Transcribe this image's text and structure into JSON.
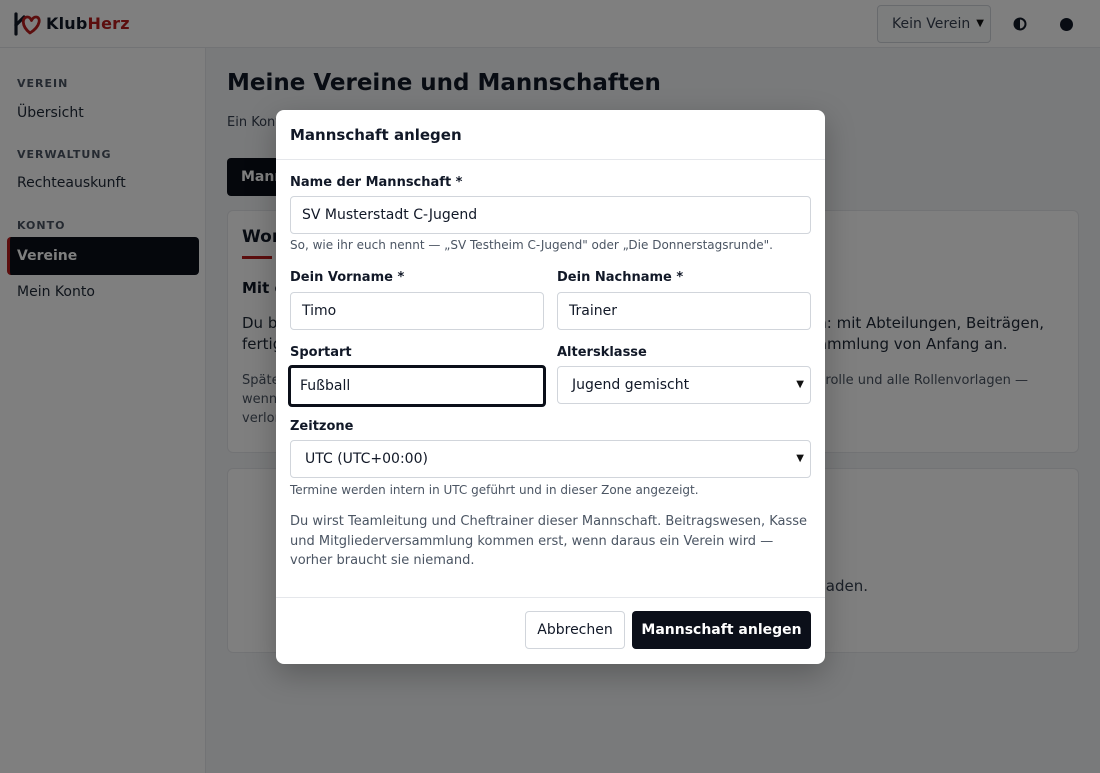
{
  "brand": {
    "name_part1": "Klub",
    "name_part2": "Herz",
    "accent": "#b91c1c"
  },
  "header": {
    "club_select": "Kein Verein",
    "theme_icon": "contrast-icon",
    "user_icon": "user-dot-icon"
  },
  "sidebar": {
    "sections": [
      {
        "title": "VEREIN",
        "items": [
          {
            "label": "Übersicht",
            "active": false
          }
        ]
      },
      {
        "title": "VERWALTUNG",
        "items": [
          {
            "label": "Rechteauskunft",
            "active": false
          }
        ]
      },
      {
        "title": "KONTO",
        "items": [
          {
            "label": "Vereine",
            "active": true
          },
          {
            "label": "Mein Konto",
            "active": false
          }
        ]
      }
    ]
  },
  "main": {
    "title": "Meine Vereine und Mannschaften",
    "subtitle_fragment": "Ein Kont",
    "tab_fragment": "Mann",
    "card1": {
      "tab_fragment": "Wor",
      "heading_fragment": "Mit e",
      "para_left_1": "Du b",
      "para_left_2": "fertig",
      "para_right_1": "ein: mit Abteilungen, Beiträgen,",
      "para_right_2": "rsammlung von Anfang an.",
      "small_left_1": "Späte",
      "small_left_2": "wenn",
      "small_left_3": "verlor",
      "small_right_1": "dsrolle und alle Rollenvorlagen —"
    },
    "card2": {
      "text_fragment": "laden."
    }
  },
  "modal": {
    "title": "Mannschaft anlegen",
    "team_name": {
      "label": "Name der Mannschaft *",
      "value": "SV Musterstadt C-Jugend",
      "help": "So, wie ihr euch nennt — „SV Testheim C-Jugend\" oder „Die Donnerstagsrunde\"."
    },
    "first_name": {
      "label": "Dein Vorname *",
      "value": "Timo"
    },
    "last_name": {
      "label": "Dein Nachname *",
      "value": "Trainer"
    },
    "sport": {
      "label": "Sportart",
      "value": "Fußball"
    },
    "age_class": {
      "label": "Altersklasse",
      "value": "Jugend gemischt"
    },
    "timezone": {
      "label": "Zeitzone",
      "value": "UTC (UTC+00:00)",
      "help": "Termine werden intern in UTC geführt und in dieser Zone angezeigt."
    },
    "info": "Du wirst Teamleitung und Cheftrainer dieser Mannschaft. Beitragswesen, Kasse und Mitgliederversammlung kommen erst, wenn daraus ein Verein wird — vorher braucht sie niemand.",
    "cancel_label": "Abbrechen",
    "submit_label": "Mannschaft anlegen"
  }
}
